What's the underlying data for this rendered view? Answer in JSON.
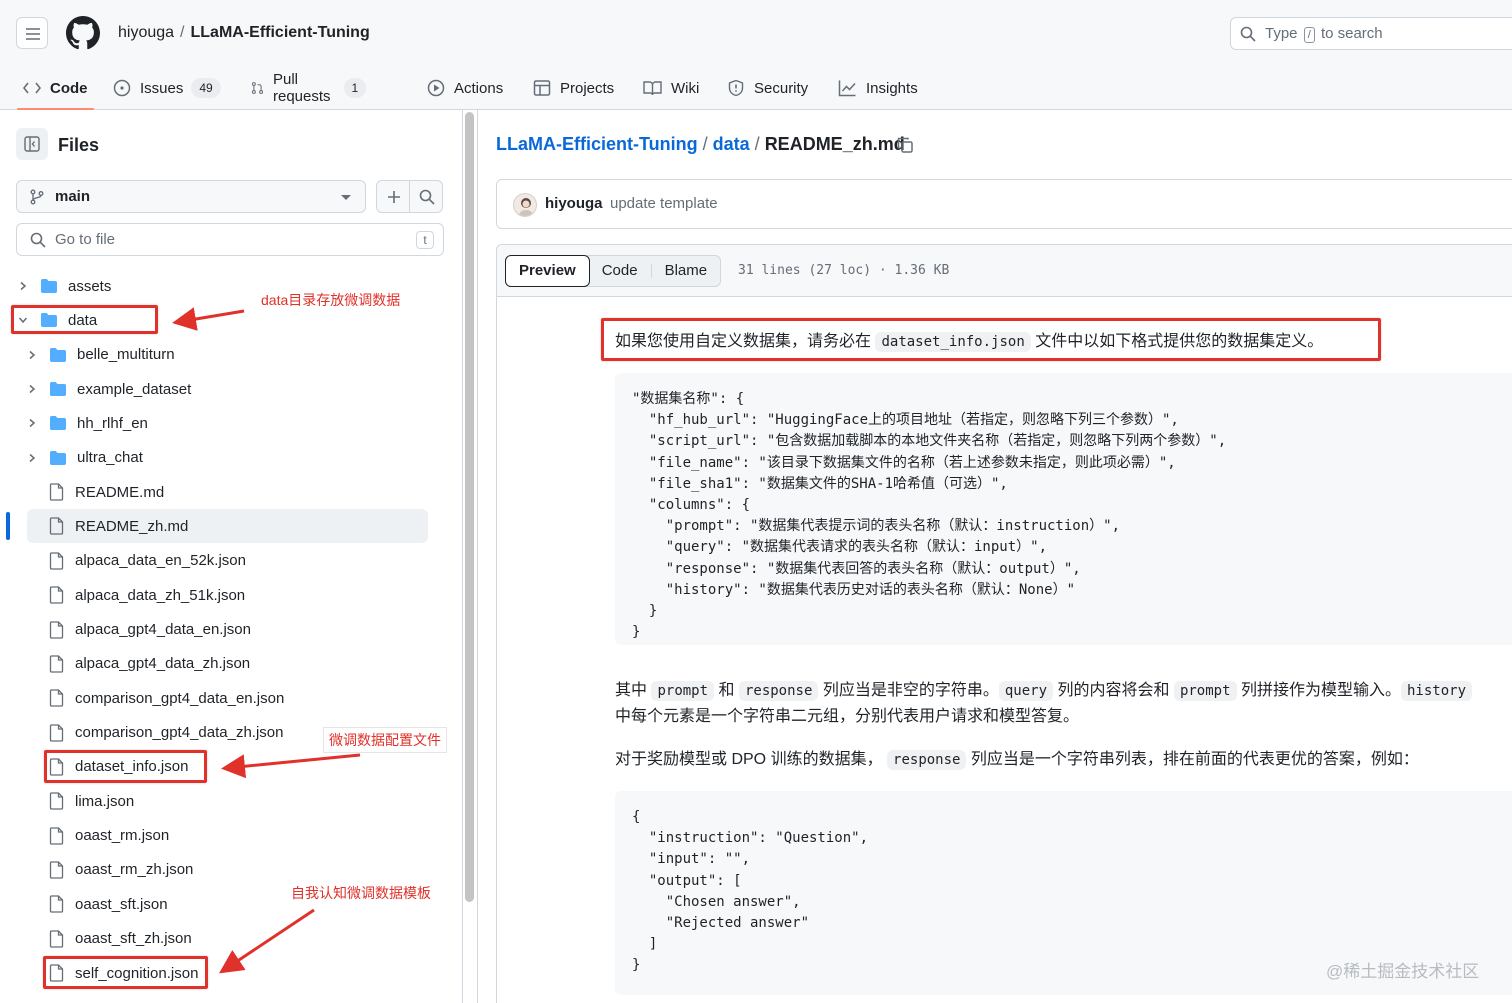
{
  "header": {
    "owner": "hiyouga",
    "separator": "/",
    "repo": "LLaMA-Efficient-Tuning",
    "search_prefix": "Type",
    "search_key": "/",
    "search_suffix": "to search"
  },
  "tabs": [
    {
      "label": "Code",
      "icon": "code-icon"
    },
    {
      "label": "Issues",
      "count": "49",
      "icon": "issue-icon"
    },
    {
      "label": "Pull requests",
      "count": "1",
      "icon": "pull-request-icon"
    },
    {
      "label": "Actions",
      "icon": "play-icon"
    },
    {
      "label": "Projects",
      "icon": "table-icon"
    },
    {
      "label": "Wiki",
      "icon": "book-icon"
    },
    {
      "label": "Security",
      "icon": "shield-icon"
    },
    {
      "label": "Insights",
      "icon": "graph-icon"
    }
  ],
  "sidebar": {
    "title": "Files",
    "branch": "main",
    "goto_placeholder": "Go to file",
    "goto_shortcut": "t",
    "tree": [
      {
        "name": "assets",
        "type": "folder",
        "expanded": false
      },
      {
        "name": "data",
        "type": "folder",
        "expanded": true
      },
      {
        "name": "belle_multiturn",
        "type": "folder",
        "expanded": false
      },
      {
        "name": "example_dataset",
        "type": "folder",
        "expanded": false
      },
      {
        "name": "hh_rlhf_en",
        "type": "folder",
        "expanded": false
      },
      {
        "name": "ultra_chat",
        "type": "folder",
        "expanded": false
      },
      {
        "name": "README.md",
        "type": "file"
      },
      {
        "name": "README_zh.md",
        "type": "file",
        "selected": true
      },
      {
        "name": "alpaca_data_en_52k.json",
        "type": "file"
      },
      {
        "name": "alpaca_data_zh_51k.json",
        "type": "file"
      },
      {
        "name": "alpaca_gpt4_data_en.json",
        "type": "file"
      },
      {
        "name": "alpaca_gpt4_data_zh.json",
        "type": "file"
      },
      {
        "name": "comparison_gpt4_data_en.json",
        "type": "file"
      },
      {
        "name": "comparison_gpt4_data_zh.json",
        "type": "file"
      },
      {
        "name": "dataset_info.json",
        "type": "file"
      },
      {
        "name": "lima.json",
        "type": "file"
      },
      {
        "name": "oaast_rm.json",
        "type": "file"
      },
      {
        "name": "oaast_rm_zh.json",
        "type": "file"
      },
      {
        "name": "oaast_sft.json",
        "type": "file"
      },
      {
        "name": "oaast_sft_zh.json",
        "type": "file"
      },
      {
        "name": "self_cognition.json",
        "type": "file"
      }
    ]
  },
  "breadcrumb": {
    "repo": "LLaMA-Efficient-Tuning",
    "folder": "data",
    "file": "README_zh.md",
    "sep": "/"
  },
  "commit": {
    "author": "hiyouga",
    "message": "update template"
  },
  "file_view": {
    "tabs": [
      "Preview",
      "Code",
      "Blame"
    ],
    "active_tab": "Preview",
    "meta": "31 lines (27 loc) · 1.36 KB"
  },
  "readme": {
    "intro_before": "如果您使用自定义数据集，请务必在",
    "intro_code": "dataset_info.json",
    "intro_after": "文件中以如下格式提供您的数据集定义。",
    "code1": "\"数据集名称\": {\n  \"hf_hub_url\": \"HuggingFace上的项目地址（若指定，则忽略下列三个参数）\",\n  \"script_url\": \"包含数据加载脚本的本地文件夹名称（若指定，则忽略下列两个参数）\",\n  \"file_name\": \"该目录下数据集文件的名称（若上述参数未指定，则此项必需）\",\n  \"file_sha1\": \"数据集文件的SHA-1哈希值（可选）\",\n  \"columns\": {\n    \"prompt\": \"数据集代表提示词的表头名称（默认：instruction）\",\n    \"query\": \"数据集代表请求的表头名称（默认：input）\",\n    \"response\": \"数据集代表回答的表头名称（默认：output）\",\n    \"history\": \"数据集代表历史对话的表头名称（默认：None）\"\n  }\n}",
    "p2_a": "其中",
    "p2_c1": "prompt",
    "p2_b": "和",
    "p2_c2": "response",
    "p2_d": "列应当是非空的字符串。",
    "p2_c3": "query",
    "p2_e": "列的内容将会和",
    "p2_c4": "prompt",
    "p2_f": "列拼接作为模型输入。",
    "p2_c5": "history",
    "p2_line2": "中每个元素是一个字符串二元组，分别代表用户请求和模型答复。",
    "p3_a": "对于奖励模型或 DPO 训练的数据集，",
    "p3_code": "response",
    "p3_b": "列应当是一个字符串列表，排在前面的代表更优的答案，例如：",
    "code2": "{\n  \"instruction\": \"Question\",\n  \"input\": \"\",\n  \"output\": [\n    \"Chosen answer\",\n    \"Rejected answer\"\n  ]\n}"
  },
  "annotations": {
    "data_dir": "data目录存放微调数据",
    "dataset_info": "微调数据配置文件",
    "self_cognition": "自我认知微调数据模板",
    "color": "#e0312a"
  },
  "watermark": "@稀土掘金技术社区"
}
